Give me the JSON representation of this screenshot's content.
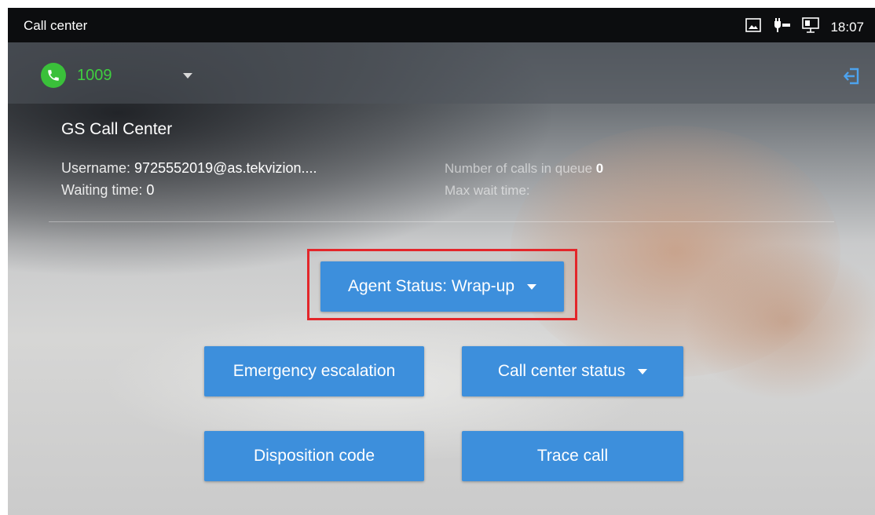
{
  "status_bar": {
    "title": "Call center",
    "time": "18:07",
    "icons": [
      "screenshot-icon",
      "poe-icon",
      "network-icon"
    ]
  },
  "account": {
    "number": "1009",
    "icons": [
      "phone-icon",
      "dropdown-caret-icon",
      "logout-icon"
    ]
  },
  "call_center": {
    "name": "GS Call Center",
    "username_label": "Username:",
    "username_value": "9725552019@as.tekvizion....",
    "waiting_label": "Waiting time:",
    "waiting_value": "0",
    "queue_label": "Number of calls in queue",
    "queue_value": "0",
    "max_wait_label": "Max wait time:",
    "max_wait_value": ""
  },
  "buttons": {
    "agent_status": "Agent Status: Wrap-up",
    "emergency": "Emergency escalation",
    "cc_status": "Call center status",
    "disposition": "Disposition code",
    "trace": "Trace call"
  },
  "colors": {
    "accent_button": "#3d8fdc",
    "highlight_box": "#e3262a",
    "account_green": "#3fcf3f"
  }
}
